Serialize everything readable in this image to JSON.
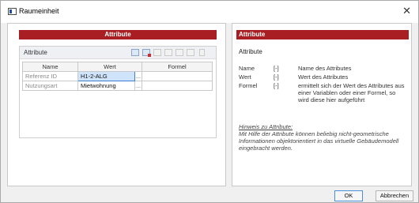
{
  "window": {
    "title": "Raumeinheit",
    "close_glyph": "✕"
  },
  "left": {
    "header": "Attribute",
    "toolbar_label": "Attribute",
    "toolbar_icons": [
      "table-add-icon",
      "table-delete-icon",
      "row-insert-icon",
      "row-append-icon",
      "row-move-icon",
      "row-copy-icon",
      "row-remove-icon"
    ],
    "columns": [
      "Name",
      "Wert",
      "Formel"
    ],
    "rows": [
      {
        "name": "Referenz ID",
        "value": "H1-2-ALG",
        "dots": "...",
        "formula": ""
      },
      {
        "name": "Nutzungsart",
        "value": "Mietwohnung",
        "dots": "...",
        "formula": ""
      }
    ]
  },
  "right": {
    "header": "Attribute",
    "subtitle": "Attribute",
    "definitions": [
      {
        "key": "Name",
        "unit": "[-]",
        "desc": "Name des Attributes"
      },
      {
        "key": "Wert",
        "unit": "[-]",
        "desc": "Wert des Attributes"
      },
      {
        "key": "Formel",
        "unit": "[-]",
        "desc": "ermittelt sich der Wert des Attributes aus einer Variablen oder einer Formel, so wird diese hier aufgeführt"
      }
    ],
    "hint_title": "Hinweis zu Attribute:",
    "hint_text": "Mit Hilfe der Attribute können beliebig nicht-geometrische Informationen objektorientiert in das virtuelle Gebäudemodell eingebracht werden."
  },
  "buttons": {
    "ok": "OK",
    "cancel": "Abbrechen"
  },
  "colors": {
    "accent_red": "#a81e23",
    "selection": "#cfe3fa"
  }
}
